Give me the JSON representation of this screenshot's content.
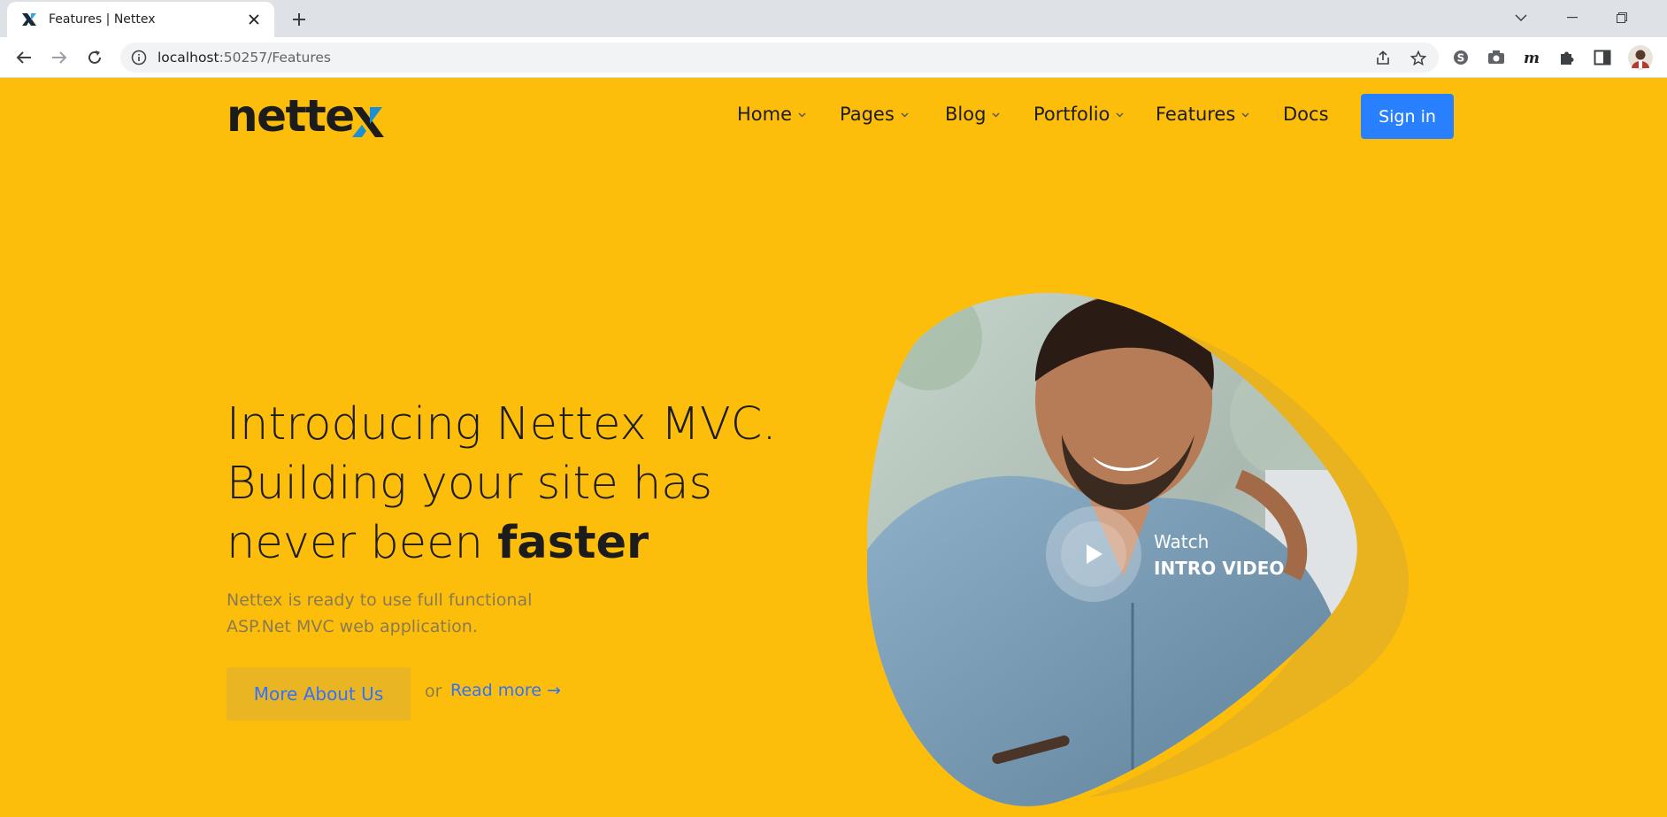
{
  "browser": {
    "tab_title": "Features | Nettex",
    "url_host": "localhost",
    "url_rest": ":50257/Features"
  },
  "site": {
    "logo_text": "nettex",
    "nav": [
      {
        "label": "Home",
        "dropdown": true
      },
      {
        "label": "Pages",
        "dropdown": true
      },
      {
        "label": "Blog",
        "dropdown": true
      },
      {
        "label": "Portfolio",
        "dropdown": true
      },
      {
        "label": "Features",
        "dropdown": true
      },
      {
        "label": "Docs",
        "dropdown": false
      }
    ],
    "signin_label": "Sign in",
    "accent_color": "#fdbe0b",
    "button_color": "#2980ff"
  },
  "hero": {
    "title_line1": "Introducing Nettex MVC.",
    "title_line2": "Building your site has",
    "title_line3_prefix": "never been ",
    "title_line3_bold": "faster",
    "desc_line1": "Nettex is ready to use full functional",
    "desc_line2": "ASP.Net MVC web application.",
    "more_button": "More About Us",
    "or_text": "or",
    "read_more": "Read more →",
    "watch_label": "Watch",
    "video_label": "INTRO VIDEO"
  }
}
